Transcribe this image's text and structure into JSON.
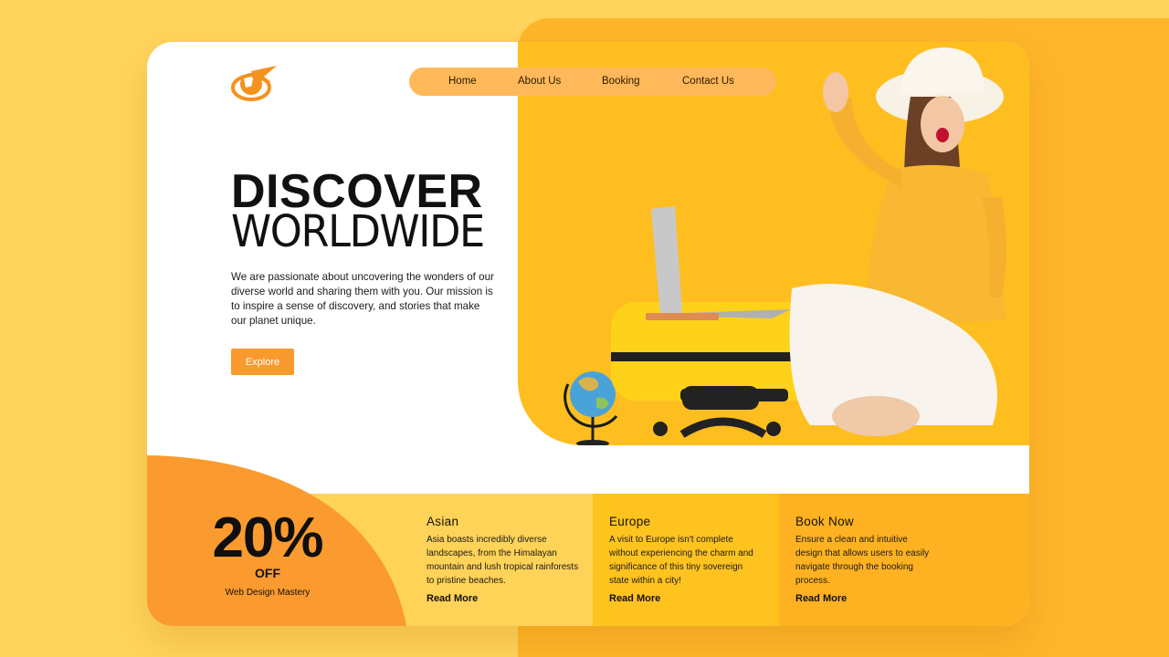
{
  "nav": {
    "items": [
      {
        "label": "Home"
      },
      {
        "label": "About Us"
      },
      {
        "label": "Booking"
      },
      {
        "label": "Contact Us"
      }
    ]
  },
  "hero": {
    "title_line1": "DISCOVER",
    "title_line2": "WORLDWIDE",
    "description": "We are passionate about uncovering the wonders of our diverse world and sharing them with you. Our mission is to inspire a sense of discovery, and stories that make our planet unique.",
    "button_label": "Explore"
  },
  "promo": {
    "percent": "20%",
    "off": "OFF",
    "caption": "Web Design Mastery"
  },
  "features": [
    {
      "title": "Asian",
      "text": "Asia boasts incredibly diverse landscapes, from the Himalayan mountain and lush tropical rainforests to pristine beaches.",
      "link": "Read More"
    },
    {
      "title": "Europe",
      "text": "A visit to Europe isn't complete without experiencing the charm and significance of this tiny sovereign state within a city!",
      "link": "Read More"
    },
    {
      "title": "Book Now",
      "text": "Ensure a clean and intuitive design that allows users to easily navigate through the booking process.",
      "link": "Read More"
    }
  ],
  "colors": {
    "page_background": "#ffd45c",
    "accent_orange": "#f99a2e",
    "hero_yellow": "#ffbe1f",
    "nav_pill": "#ffb85a",
    "feature_asian": "#ffd357",
    "feature_europe": "#ffc320",
    "feature_book": "#ffb221"
  },
  "icons": {
    "logo": "globe-airplane-logo"
  }
}
